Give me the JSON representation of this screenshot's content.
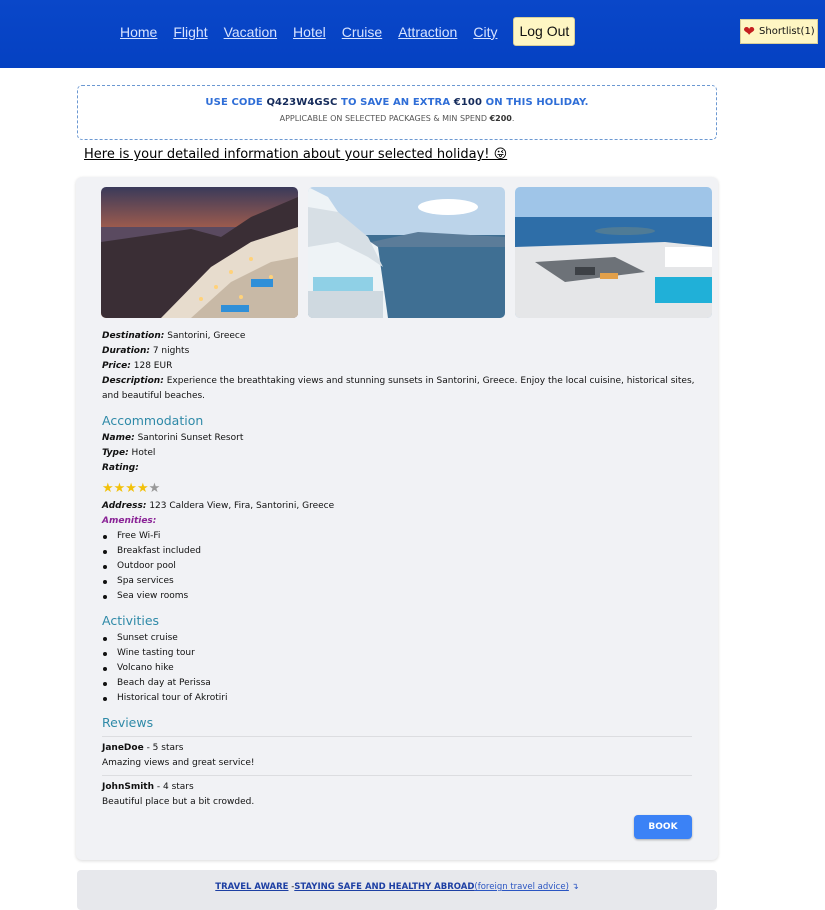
{
  "nav": {
    "items": [
      "Home",
      "Flight",
      "Vacation",
      "Hotel",
      "Cruise",
      "Attraction",
      "City"
    ],
    "logout": "Log Out",
    "shortlist": "Shortlist(1)"
  },
  "promo": {
    "prefix": "USE CODE",
    "code": "Q423W4GSC",
    "middle": "TO SAVE AN EXTRA",
    "amount": "€100",
    "suffix": "ON THIS HOLIDAY.",
    "sub_prefix": "APPLICABLE ON SELECTED PACKAGES & MIN SPEND",
    "sub_amount": "€200",
    "sub_suffix": "."
  },
  "intro": "Here is your detailed information about your selected holiday! 😜",
  "holiday": {
    "destination_label": "Destination:",
    "destination": "Santorini, Greece",
    "duration_label": "Duration:",
    "duration": "7 nights",
    "price_label": "Price:",
    "price": "128 EUR",
    "description_label": "Description:",
    "description": "Experience the breathtaking views and stunning sunsets in Santorini, Greece. Enjoy the local cuisine, historical sites, and beautiful beaches."
  },
  "accommodation": {
    "title": "Accommodation",
    "name_label": "Name:",
    "name": "Santorini Sunset Resort",
    "type_label": "Type:",
    "type": "Hotel",
    "rating_label": "Rating:",
    "rating_value": 4.5,
    "stars_full": "★★★★",
    "stars_half": "★",
    "address_label": "Address:",
    "address": "123 Caldera View, Fira, Santorini, Greece",
    "amenities_label": "Amenities:",
    "amenities": [
      "Free Wi-Fi",
      "Breakfast included",
      "Outdoor pool",
      "Spa services",
      "Sea view rooms"
    ]
  },
  "activities": {
    "title": "Activities",
    "items": [
      "Sunset cruise",
      "Wine tasting tour",
      "Volcano hike",
      "Beach day at Perissa",
      "Historical tour of Akrotiri"
    ]
  },
  "reviews": {
    "title": "Reviews",
    "items": [
      {
        "user": "JaneDoe",
        "stars": " - 5 stars",
        "text": "Amazing views and great service!"
      },
      {
        "user": "JohnSmith",
        "stars": " - 4 stars",
        "text": "Beautiful place but a bit crowded."
      }
    ]
  },
  "book": "BOOK",
  "footer": {
    "link1": "TRAVEL AWARE",
    "sep": " -",
    "link2": "STAYING SAFE AND HEALTHY ABROAD",
    "link3": "(foreign travel advice)",
    "icon": "↴"
  },
  "colors": {
    "header": "#0441c2",
    "accent": "#3b82f6",
    "section": "#2f8aa8",
    "star": "#f2c10a"
  }
}
